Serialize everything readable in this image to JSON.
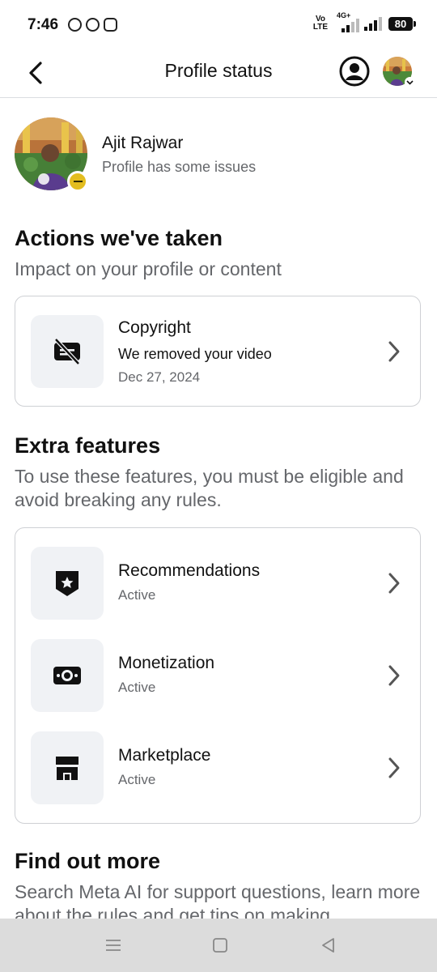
{
  "status_bar": {
    "time": "7:46",
    "network": "4G+",
    "volte": "Vo LTE",
    "battery": "80"
  },
  "header": {
    "title": "Profile status"
  },
  "profile": {
    "name": "Ajit Rajwar",
    "status": "Profile has some issues"
  },
  "actions": {
    "title": "Actions we've taken",
    "subtitle": "Impact on your profile or content",
    "items": [
      {
        "icon": "removed-video-icon",
        "title": "Copyright",
        "detail": "We removed your video",
        "date": "Dec 27, 2024"
      }
    ]
  },
  "extra": {
    "title": "Extra features",
    "subtitle": "To use these features, you must be eligible and avoid breaking any rules.",
    "items": [
      {
        "icon": "shield-star-icon",
        "title": "Recommendations",
        "status": "Active"
      },
      {
        "icon": "money-icon",
        "title": "Monetization",
        "status": "Active"
      },
      {
        "icon": "shop-icon",
        "title": "Marketplace",
        "status": "Active"
      }
    ]
  },
  "find_more": {
    "title": "Find out more",
    "subtitle": "Search Meta AI for support questions, learn more about the rules and get tips on making"
  },
  "colors": {
    "badge": "#e3bd1f",
    "tile_bg": "#f0f2f5",
    "secondary_text": "#65676b",
    "nav_bg": "#dcdcdc"
  }
}
